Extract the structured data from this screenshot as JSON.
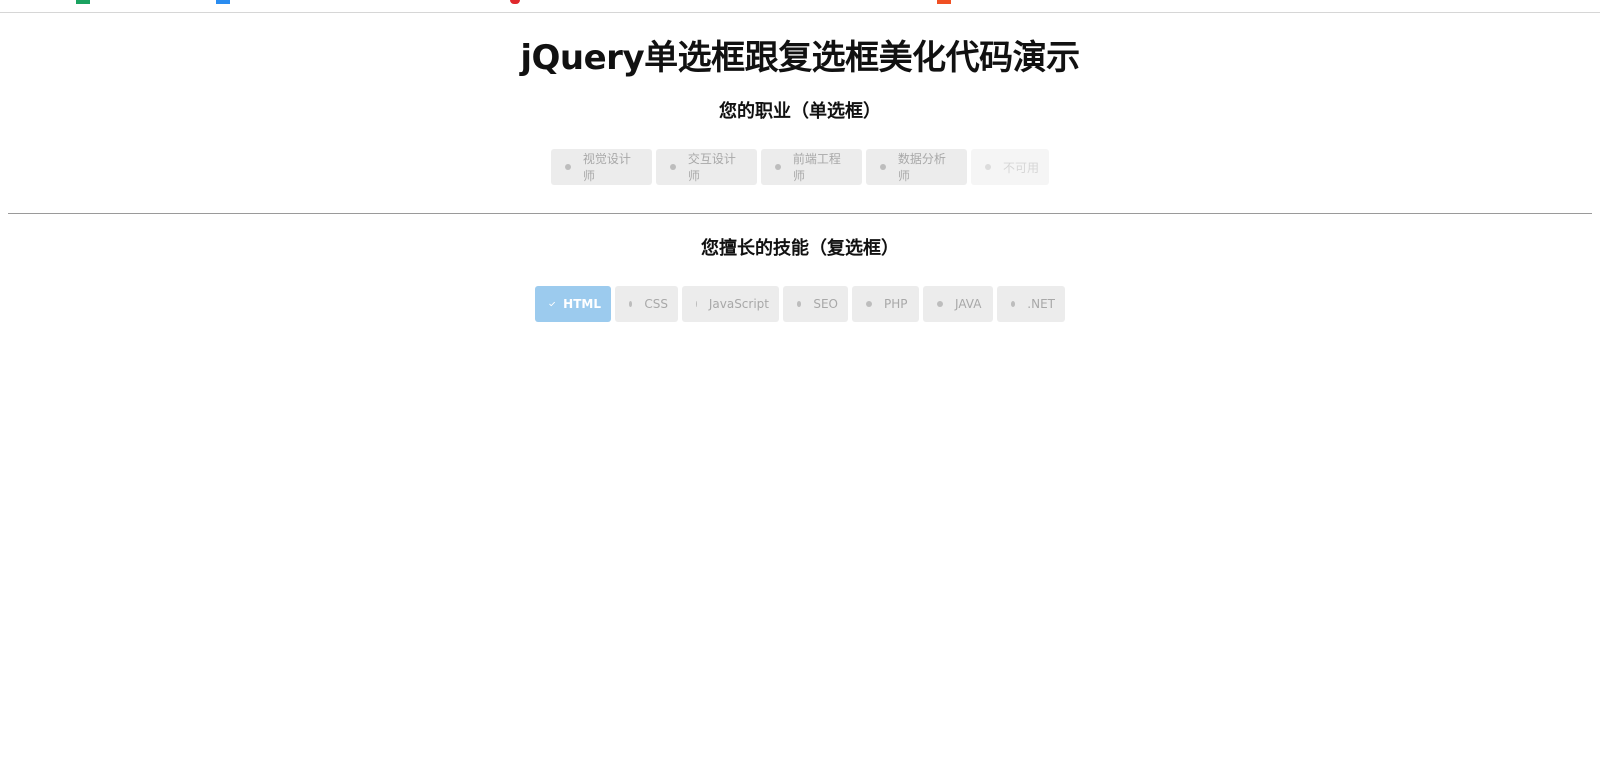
{
  "page": {
    "title": "jQuery单选框跟复选框美化代码演示"
  },
  "radio_section": {
    "title": "您的职业（单选框）",
    "options": [
      {
        "label": "视觉设计师",
        "state": "unchecked"
      },
      {
        "label": "交互设计师",
        "state": "unchecked"
      },
      {
        "label": "前端工程师",
        "state": "unchecked"
      },
      {
        "label": "数据分析师",
        "state": "unchecked"
      },
      {
        "label": "不可用",
        "state": "disabled"
      }
    ]
  },
  "checkbox_section": {
    "title": "您擅长的技能（复选框）",
    "options": [
      {
        "label": "HTML",
        "state": "checked"
      },
      {
        "label": "CSS",
        "state": "unchecked"
      },
      {
        "label": "JavaScript",
        "state": "unchecked"
      },
      {
        "label": "SEO",
        "state": "unchecked"
      },
      {
        "label": "PHP",
        "state": "unchecked"
      },
      {
        "label": "JAVA",
        "state": "unchecked"
      },
      {
        "label": ".NET",
        "state": "unchecked"
      }
    ]
  },
  "colors": {
    "checked_bg": "#9ccbee",
    "option_bg": "#ececec",
    "disabled_bg": "#f5f5f5"
  }
}
